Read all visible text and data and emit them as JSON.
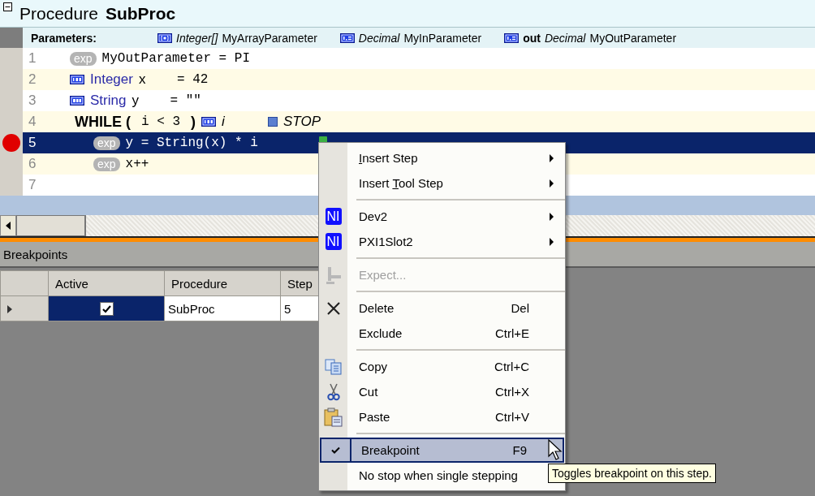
{
  "procedure": {
    "keyword": "Procedure",
    "name": "SubProc",
    "expanded": true
  },
  "parameters": {
    "label": "Parameters:",
    "items": [
      {
        "kind": "array",
        "type": "Integer[]",
        "name": "MyArrayParameter"
      },
      {
        "kind": "decimal",
        "type": "Decimal",
        "name": "MyInParameter"
      },
      {
        "kind": "decimal",
        "direction": "out",
        "type": "Decimal",
        "name": "MyOutParameter"
      }
    ]
  },
  "code_lines": [
    {
      "number": "1",
      "kind": "expression",
      "badge": "exp",
      "text": "MyOutParameter = PI",
      "selected": false,
      "breakpoint": false
    },
    {
      "number": "2",
      "kind": "declaration",
      "type": {
        "kind": "integer",
        "name": "Integer"
      },
      "name": "x",
      "value": "= 42",
      "selected": false,
      "breakpoint": false
    },
    {
      "number": "3",
      "kind": "declaration",
      "type": {
        "kind": "string",
        "name": "String"
      },
      "name": "y",
      "value": "= \"\"",
      "selected": false,
      "breakpoint": false
    },
    {
      "number": "4",
      "kind": "while",
      "keyword": "WHILE (",
      "condition": "i < 3",
      "close": ")",
      "loop_var": "i",
      "stop_label": "STOP",
      "selected": false,
      "breakpoint": false,
      "children": [
        {
          "number": "5",
          "kind": "expression",
          "badge": "exp",
          "text": "y = String(x) * i",
          "selected": true,
          "breakpoint": true
        },
        {
          "number": "6",
          "kind": "expression",
          "badge": "exp",
          "text": "x++",
          "selected": false,
          "breakpoint": false
        }
      ]
    },
    {
      "number": "7",
      "kind": "empty",
      "selected": false,
      "breakpoint": false
    }
  ],
  "breakpoints": {
    "title": "Breakpoints",
    "columns": [
      "Active",
      "Procedure",
      "Step"
    ],
    "rows": [
      {
        "active": true,
        "procedure": "SubProc",
        "step": "5",
        "selected": true
      }
    ]
  },
  "context_menu": [
    {
      "kind": "plain",
      "key": "I",
      "after": "nsert Step",
      "submenu": true,
      "disabled": false,
      "checked": false,
      "highlighted": false
    },
    {
      "kind": "plain",
      "before": "Insert ",
      "key": "T",
      "after": "ool Step",
      "submenu": true,
      "disabled": false,
      "checked": false,
      "highlighted": false
    },
    {
      "kind": "separator"
    },
    {
      "kind": "ni",
      "badge": "NI",
      "after": "Dev2",
      "submenu": true,
      "disabled": false,
      "checked": false,
      "highlighted": false
    },
    {
      "kind": "ni",
      "badge": "NI",
      "after": "PXI1Slot2",
      "submenu": true,
      "disabled": false,
      "checked": false,
      "highlighted": false
    },
    {
      "kind": "separator"
    },
    {
      "kind": "stamp",
      "after": "Expect...",
      "submenu": false,
      "disabled": true,
      "checked": false,
      "highlighted": false
    },
    {
      "kind": "separator"
    },
    {
      "kind": "delete",
      "after": "Delete",
      "shortcut": "Del",
      "submenu": false,
      "disabled": false,
      "checked": false,
      "highlighted": false
    },
    {
      "kind": "plain",
      "after": "Exclude",
      "shortcut": "Ctrl+E",
      "submenu": false,
      "disabled": false,
      "checked": false,
      "highlighted": false
    },
    {
      "kind": "separator"
    },
    {
      "kind": "copy",
      "after": "Copy",
      "shortcut": "Ctrl+C",
      "submenu": false,
      "disabled": false,
      "checked": false,
      "highlighted": false
    },
    {
      "kind": "cut",
      "after": "Cut",
      "shortcut": "Ctrl+X",
      "submenu": false,
      "disabled": false,
      "checked": false,
      "highlighted": false
    },
    {
      "kind": "paste",
      "after": "Paste",
      "shortcut": "Ctrl+V",
      "submenu": false,
      "disabled": false,
      "checked": false,
      "highlighted": false
    },
    {
      "kind": "separator"
    },
    {
      "kind": "plain",
      "after": "Breakpoint",
      "shortcut": "F9",
      "submenu": false,
      "disabled": false,
      "checked": true,
      "highlighted": true
    },
    {
      "kind": "plain",
      "after": "No stop when single stepping",
      "submenu": false,
      "disabled": false,
      "checked": false,
      "highlighted": false
    }
  ],
  "tooltip": "Toggles breakpoint on this step."
}
